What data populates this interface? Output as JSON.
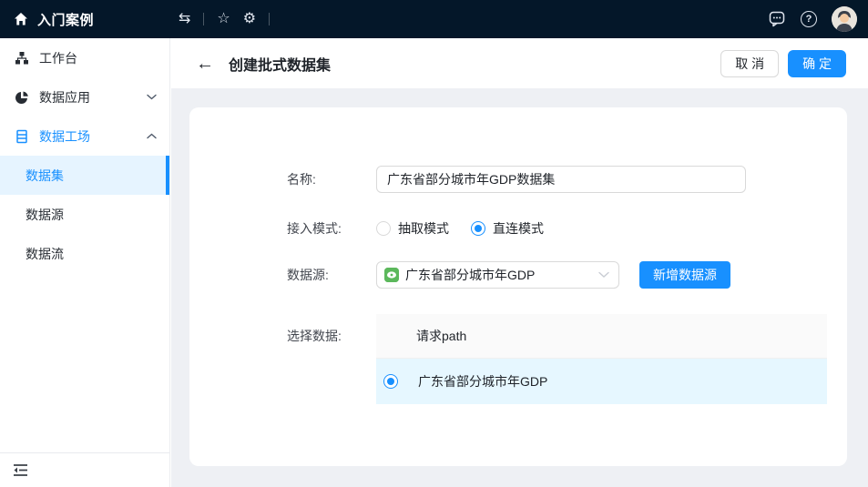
{
  "colors": {
    "topbar_bg": "#041729",
    "accent": "#1890ff",
    "page_bg": "#eef0f4",
    "sidebar_selected_bg": "#e6f4ff",
    "table_header_bg": "#fafafa",
    "table_row_selected_bg": "#e6f7ff",
    "source_icon_green": "#5cb85c"
  },
  "topbar": {
    "title": "入门案例",
    "icons": [
      "home-icon",
      "swap-icon",
      "star-icon",
      "gear-icon",
      "chat-icon",
      "help-icon",
      "avatar"
    ],
    "swap_glyph": "⇆",
    "star_glyph": "☆",
    "gear_glyph": "⚙",
    "help_glyph": "?"
  },
  "sidebar": {
    "items": [
      {
        "label": "工作台",
        "icon": "sitemap-icon",
        "chevron": "none",
        "active": false
      },
      {
        "label": "数据应用",
        "icon": "pie-icon",
        "chevron": "down",
        "active": false
      },
      {
        "label": "数据工场",
        "icon": "list-icon",
        "chevron": "up",
        "active": true
      }
    ],
    "subitems": [
      {
        "label": "数据集",
        "selected": true
      },
      {
        "label": "数据源",
        "selected": false
      },
      {
        "label": "数据流",
        "selected": false
      }
    ],
    "collapse_icon": "menu-fold-icon"
  },
  "header": {
    "back_glyph": "←",
    "title": "创建批式数据集",
    "cancel_label": "取 消",
    "confirm_label": "确 定"
  },
  "form": {
    "name": {
      "label": "名称:",
      "value": "广东省部分城市年GDP数据集"
    },
    "mode": {
      "label": "接入模式:",
      "options": [
        {
          "label": "抽取模式",
          "selected": false
        },
        {
          "label": "直连模式",
          "selected": true
        }
      ]
    },
    "source": {
      "label": "数据源:",
      "value": "广东省部分城市年GDP",
      "add_button_label": "新增数据源"
    },
    "dataset": {
      "label": "选择数据:",
      "table": {
        "header": "请求path",
        "rows": [
          {
            "label": "广东省部分城市年GDP",
            "selected": true
          }
        ]
      }
    }
  }
}
